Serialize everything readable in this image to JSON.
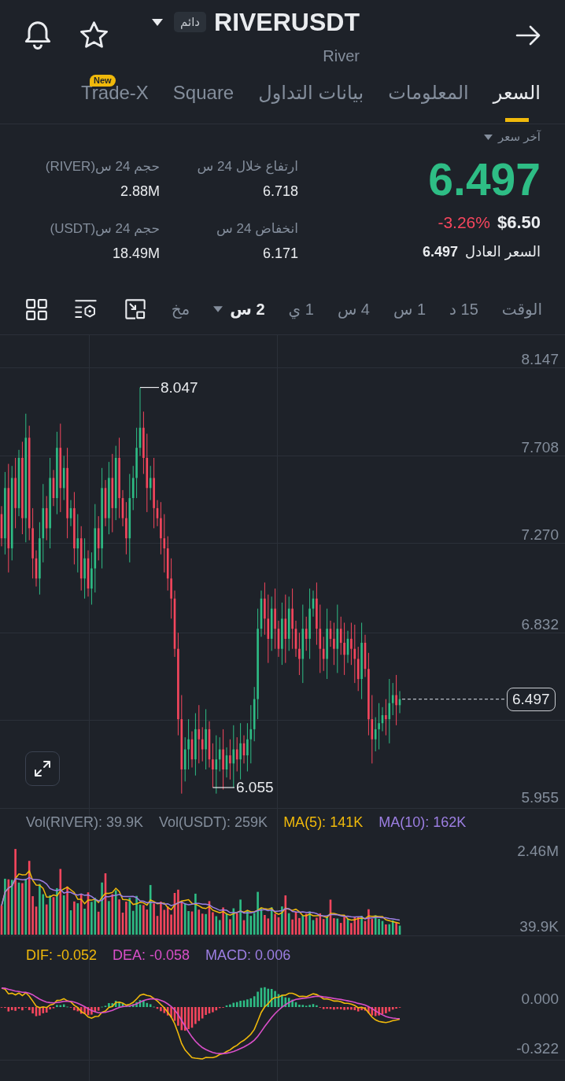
{
  "header": {
    "title": "RIVERUSDT",
    "contract_badge": "دائم",
    "subtitle": "River"
  },
  "tabs": [
    {
      "label": "السعر",
      "selected": true
    },
    {
      "label": "المعلومات",
      "selected": false
    },
    {
      "label": "بيانات التداول",
      "selected": false
    },
    {
      "label": "Square",
      "selected": false
    },
    {
      "label": "Trade-X",
      "selected": false,
      "badge": "New"
    }
  ],
  "price": {
    "type_label": "آخر سعر",
    "last": {
      "text": "6.497",
      "rising": true
    },
    "usd": "$6.50",
    "change": {
      "text": "-3.26%",
      "rising": false
    },
    "fair_label": "السعر العادل",
    "fair_value": "6.497"
  },
  "stats": [
    {
      "label": "ارتفاع خلال 24 س",
      "value": "6.718"
    },
    {
      "label": "حجم 24 س(RIVER)",
      "value": "2.88M"
    },
    {
      "label": "انخفاض 24 س",
      "value": "6.171"
    },
    {
      "label": "حجم 24 س(USDT)",
      "value": "18.49M"
    }
  ],
  "intervals": {
    "label": "الوقت",
    "items": [
      {
        "label": "15 د",
        "selected": false,
        "dropdown": false
      },
      {
        "label": "1 س",
        "selected": false,
        "dropdown": false
      },
      {
        "label": "4 س",
        "selected": false,
        "dropdown": false
      },
      {
        "label": "1 ي",
        "selected": false,
        "dropdown": false
      },
      {
        "label": "2 س",
        "selected": true,
        "dropdown": true
      }
    ],
    "truncated_item": "مخ"
  },
  "chart": {
    "price_axis": [
      "8.147",
      "7.708",
      "7.270",
      "6.832",
      "5.955"
    ],
    "high_marker": "8.047",
    "low_marker": "6.055",
    "last_price": "6.497",
    "volume_legend": [
      {
        "text": "MA(10): 162K",
        "color": "#9d7fe3"
      },
      {
        "text": "MA(5): 141K",
        "color": "#f0b90b"
      },
      {
        "text": "Vol(USDT): 259K",
        "color": "#848e9c"
      },
      {
        "text": "Vol(RIVER): 39.9K",
        "color": "#848e9c"
      }
    ],
    "volume_axis": [
      "2.46M",
      "39.9K"
    ],
    "macd_legend": [
      {
        "text": "MACD: 0.006",
        "color": "#9d7fe3"
      },
      {
        "text": "DEA: -0.058",
        "color": "#d94fc9"
      },
      {
        "text": "DIF: -0.052",
        "color": "#f0b90b"
      }
    ],
    "macd_axis": [
      "0.000",
      "-0.322"
    ]
  }
}
